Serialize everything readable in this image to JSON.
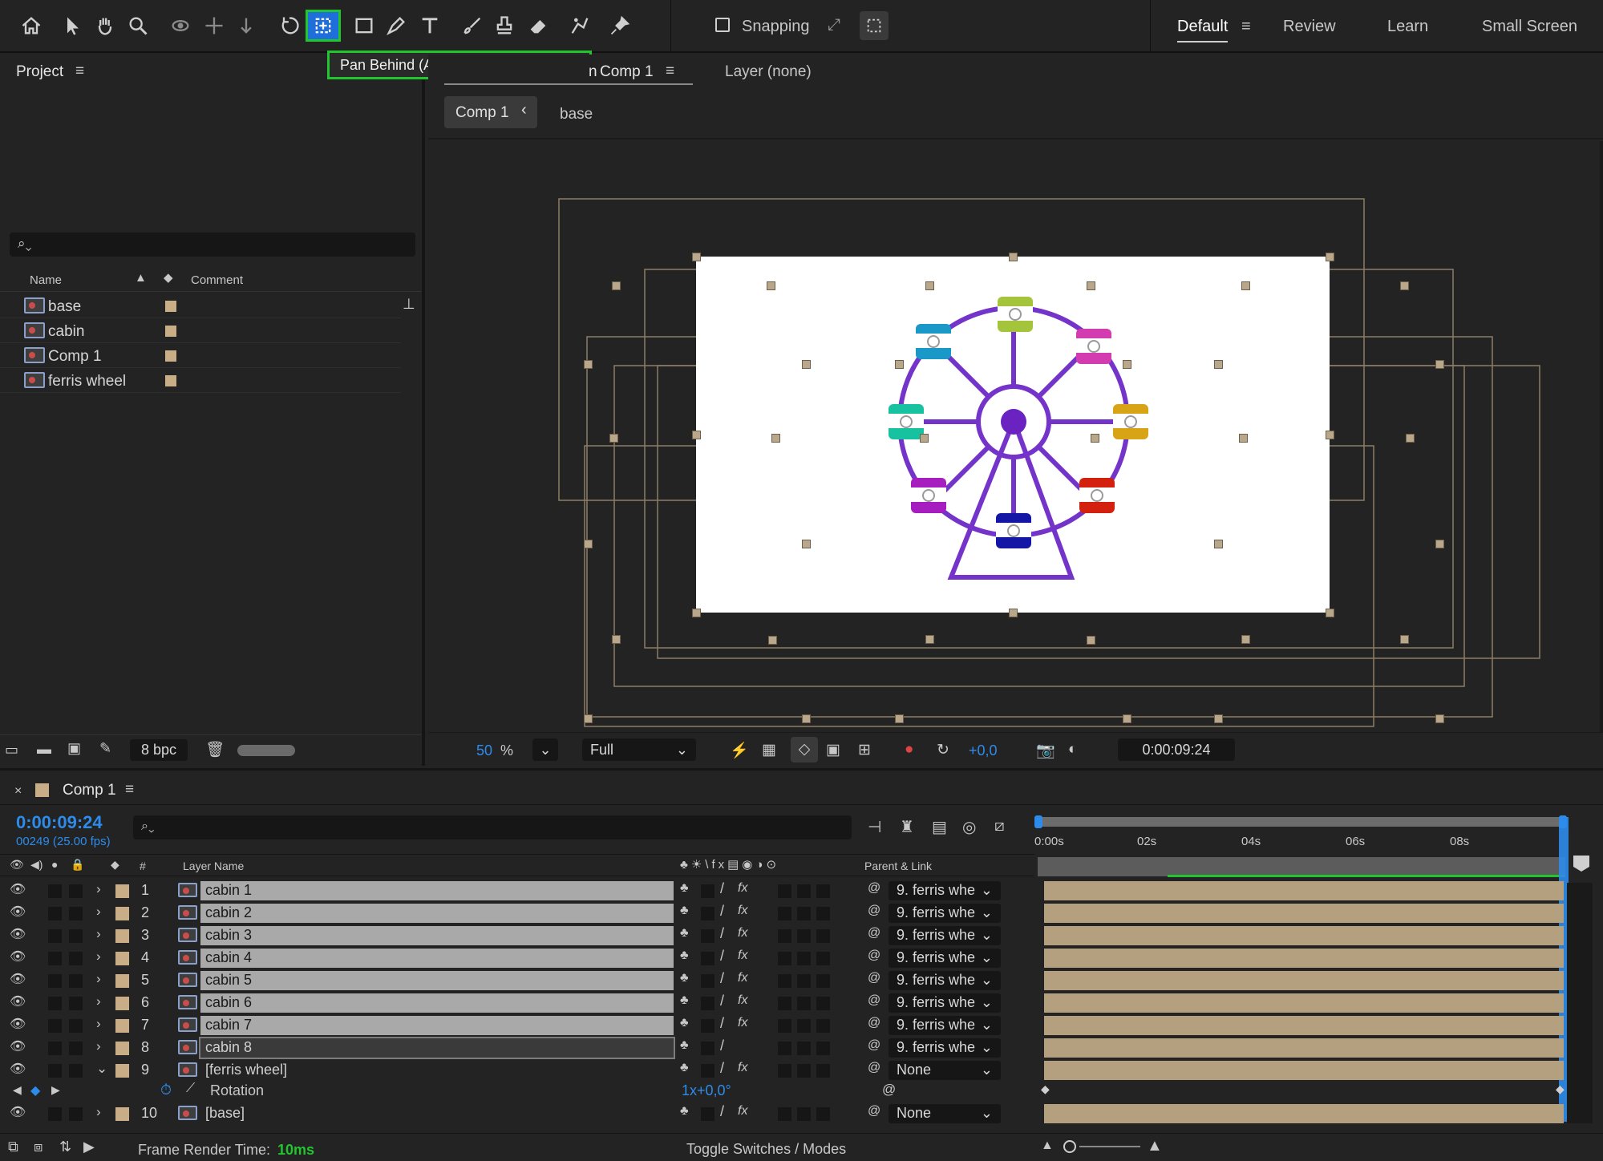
{
  "toolbar": {
    "snapping_label": "Snapping",
    "tooltip": "Pan Behind (Anchor Point) Tool (Y)",
    "workspaces": [
      "Default",
      "Review",
      "Learn",
      "Small Screen"
    ]
  },
  "project": {
    "title": "Project",
    "columns": {
      "name": "Name",
      "comment": "Comment"
    },
    "items": [
      {
        "name": "base"
      },
      {
        "name": "cabin"
      },
      {
        "name": "Comp 1"
      },
      {
        "name": "ferris wheel"
      }
    ],
    "bpc": "8 bpc"
  },
  "composition": {
    "tab_label": "Comp 1",
    "tab_prefix": "n",
    "layer_tab": "Layer (none)",
    "breadcrumb_comp": "Comp 1",
    "breadcrumb_layer": "base",
    "zoom": "50",
    "zoom_unit": "%",
    "resolution": "Full",
    "exposure": "+0,0",
    "timecode": "0:00:09:24"
  },
  "timeline": {
    "tab_label": "Comp 1",
    "timecode": "0:00:09:24",
    "frames": "00249 (25.00 fps)",
    "col_num": "#",
    "col_layer_name": "Layer Name",
    "col_parent": "Parent & Link",
    "ruler": [
      "0:00s",
      "02s",
      "04s",
      "06s",
      "08s"
    ],
    "layers": [
      {
        "num": "1",
        "name": "cabin 1",
        "parent": "9. ferris whe"
      },
      {
        "num": "2",
        "name": "cabin 2",
        "parent": "9. ferris whe"
      },
      {
        "num": "3",
        "name": "cabin 3",
        "parent": "9. ferris whe"
      },
      {
        "num": "4",
        "name": "cabin 4",
        "parent": "9. ferris whe"
      },
      {
        "num": "5",
        "name": "cabin 5",
        "parent": "9. ferris whe"
      },
      {
        "num": "6",
        "name": "cabin 6",
        "parent": "9. ferris whe"
      },
      {
        "num": "7",
        "name": "cabin 7",
        "parent": "9. ferris whe"
      },
      {
        "num": "8",
        "name": "cabin 8",
        "parent": "9. ferris whe"
      },
      {
        "num": "9",
        "name": "[ferris wheel]",
        "parent": "None"
      },
      {
        "num": "10",
        "name": "[base]",
        "parent": "None"
      }
    ],
    "rotation_label": "Rotation",
    "rotation_value": "1x+0,0°",
    "frame_render_label": "Frame Render Time:",
    "frame_render_value": "10ms",
    "toggle_label": "Toggle Switches / Modes"
  },
  "colors": {
    "accent_blue": "#2d8ceb",
    "highlight_green": "#22c52d",
    "wheel_purple": "#7433c9",
    "layer_bar": "#b49f7e"
  }
}
